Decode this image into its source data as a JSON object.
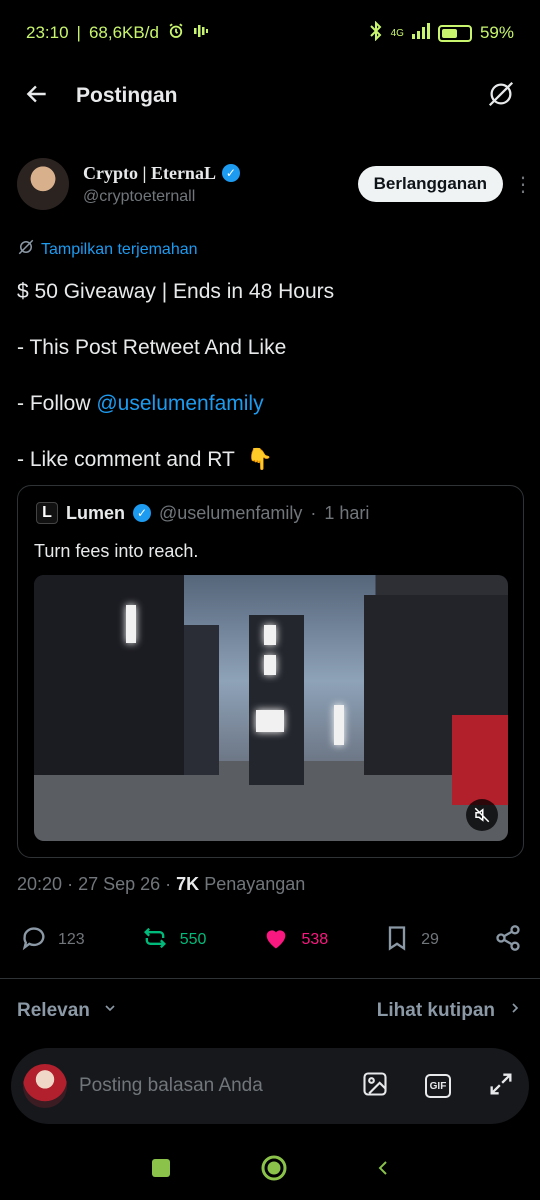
{
  "status_bar": {
    "time": "23:10",
    "network_speed": "68,6KB/d",
    "network_type": "4G",
    "battery": "59%",
    "battery_level": 0.59,
    "color": "#c8f56d"
  },
  "header": {
    "title": "Postingan",
    "back_icon": "arrow-left-icon",
    "right_icon": "grok-icon"
  },
  "author": {
    "name": "Crypto | EternaL",
    "handle": "@cryptoeternall",
    "subscribe_label": "Berlangganan",
    "more_icon": "more-vertical-icon"
  },
  "translate_label": "Tampilkan terjemahan",
  "post": {
    "line1": "$ 50 Giveaway | Ends in 48 Hours",
    "line2": "- This Post Retweet And Like",
    "line3_prefix": "- Follow ",
    "line3_mention": "@uselumenfamily",
    "line4": "-  Like comment and RT",
    "line4_emoji": "👇"
  },
  "quote": {
    "name": "Lumen",
    "handle": "@uselumenfamily",
    "time": "1 hari",
    "text": "Turn fees into reach.",
    "logo_letter": "L",
    "mute_icon": "volume-off-icon"
  },
  "meta": {
    "time": "20:20",
    "date": "27 Sep 26",
    "views_count": "7K",
    "views_label": "Penayangan"
  },
  "actions": {
    "replies": "123",
    "reposts": "550",
    "likes": "538",
    "bookmarks": "29"
  },
  "sort": {
    "left_label": "Relevan",
    "right_label": "Lihat kutipan"
  },
  "reply": {
    "placeholder": "Posting balasan Anda",
    "gif_label": "GIF"
  },
  "colors": {
    "accent": "#1d9bf0",
    "repost": "#00ba7c",
    "like": "#f91880",
    "muted": "#71767b",
    "nav": "#8bc34a"
  }
}
